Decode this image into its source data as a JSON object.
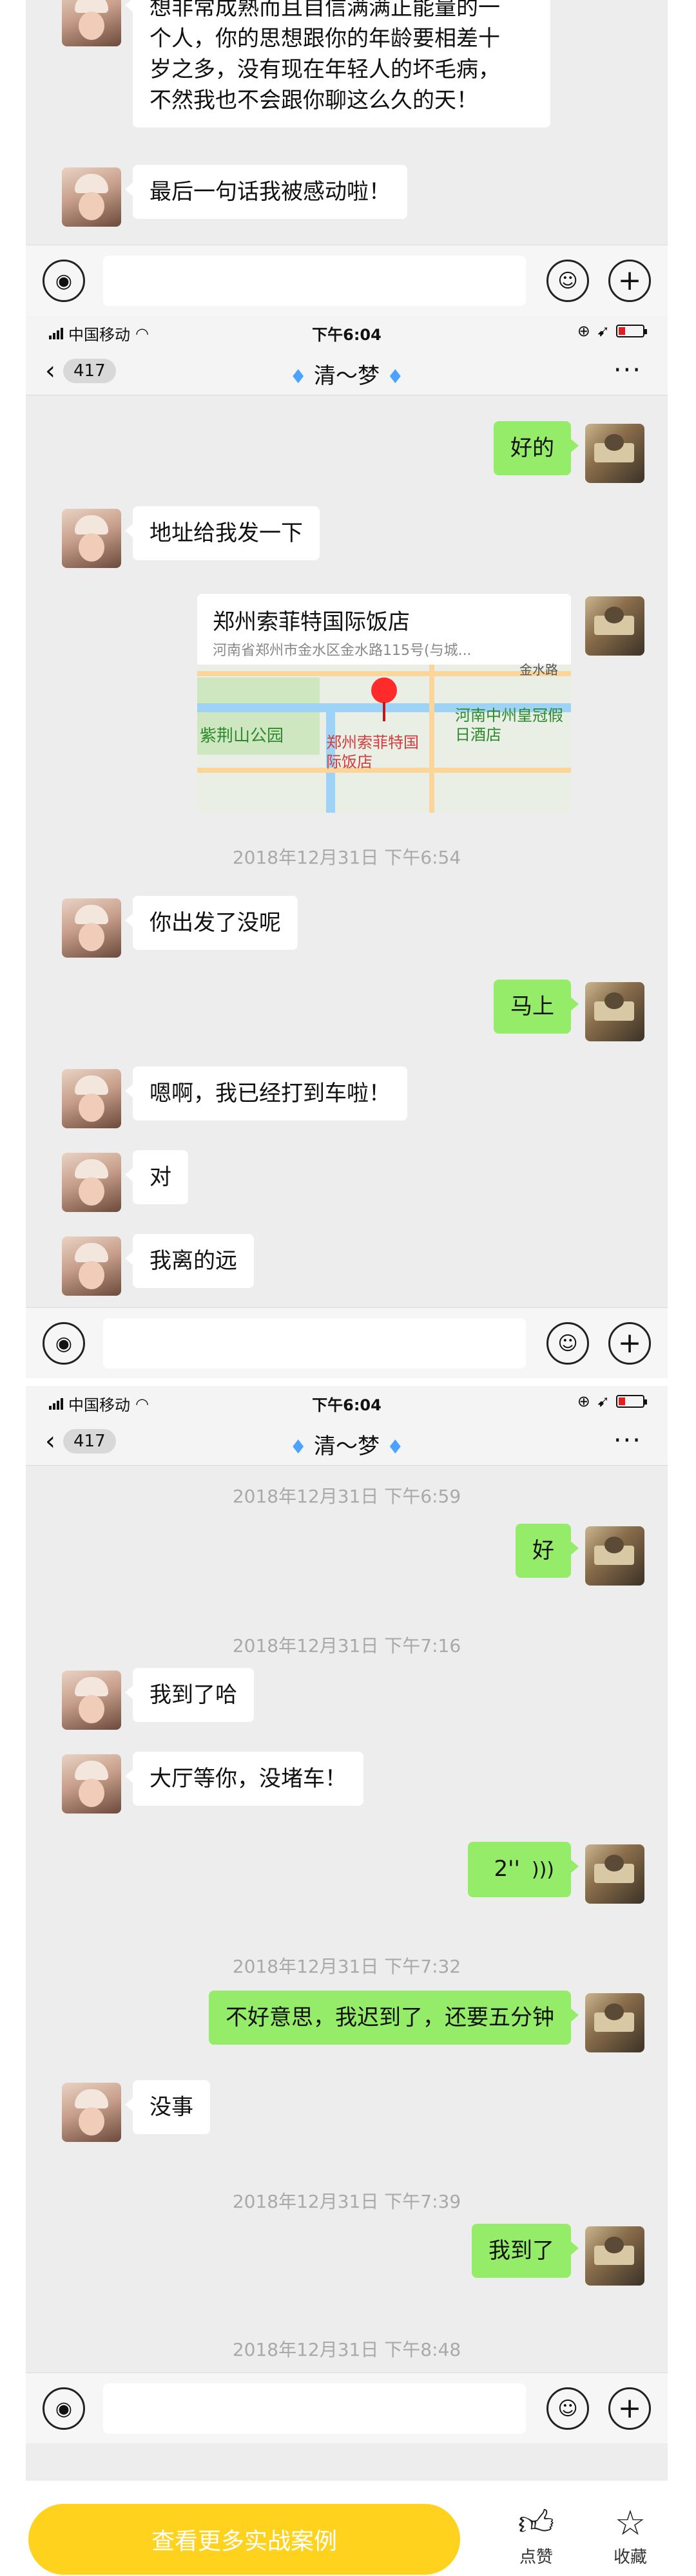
{
  "status_bar": {
    "carrier": "中国移动",
    "time": "下午6:04"
  },
  "nav": {
    "unread_count": "417",
    "contact_name": "清～梦"
  },
  "screen1": {
    "messages": [
      {
        "text": "个人，你的思想跟你的年龄要相差十"
      },
      {
        "text": "想非常成熟而且自信满满正能量的一"
      },
      {
        "text": "岁之多，没有现在年轻人的坏毛病，"
      },
      {
        "text": "不然我也不会跟你聊这么久的天！"
      },
      {
        "text": "最后一句话我被感动啦！"
      }
    ]
  },
  "screen2": {
    "messages": [
      {
        "text": "好的"
      },
      {
        "text": "地址给我发一下"
      },
      {
        "text": "2018年12月31日 下午6:54"
      },
      {
        "text": "你出发了没呢"
      },
      {
        "text": "马上"
      },
      {
        "text": "嗯啊，我已经打到车啦！"
      },
      {
        "text": "对"
      },
      {
        "text": "我离的远"
      }
    ],
    "location": {
      "name": "郑州索菲特国际饭店",
      "address": "河南省郑州市金水区金水路115号(与城...",
      "map_labels": [
        "紫荆山公园",
        "郑州索菲特国际饭店",
        "河南中州皇冠假日酒店",
        "金水路"
      ]
    }
  },
  "screen3": {
    "messages": [
      {
        "text": "2018年12月31日 下午6:59"
      },
      {
        "text": "好"
      },
      {
        "text": "2018年12月31日 下午7:16"
      },
      {
        "text": "我到了哈"
      },
      {
        "text": "大厅等你，没堵车！"
      },
      {
        "text": "2''"
      },
      {
        "text": "2018年12月31日 下午7:32"
      },
      {
        "text": "不好意思，我迟到了，还要五分钟"
      },
      {
        "text": "没事"
      },
      {
        "text": "2018年12月31日 下午7:39"
      },
      {
        "text": "我到了"
      },
      {
        "text": "2018年12月31日 下午8:48"
      }
    ]
  },
  "bottom": {
    "cta": "查看更多实战案例",
    "like_label": "点赞",
    "favorite_label": "收藏"
  },
  "colors": {
    "my_bubble": "#95ec69",
    "her_bubble": "#ffffff",
    "cta": "#ffd21e"
  },
  "icons": [
    "voice-icon",
    "emoji-icon",
    "plus-icon",
    "back-chevron-icon",
    "more-icon",
    "thumbs-up-icon",
    "star-icon",
    "wifi-icon",
    "battery-icon",
    "gem-icon"
  ]
}
